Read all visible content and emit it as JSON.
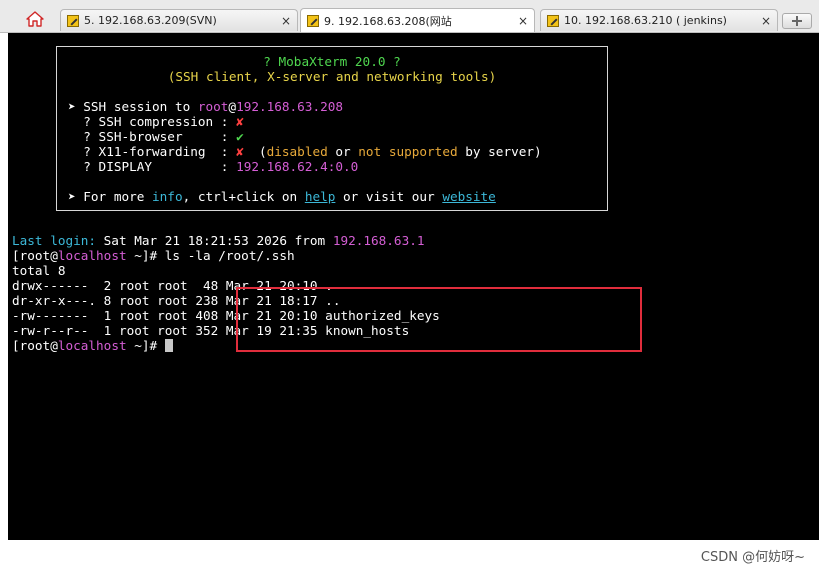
{
  "tabs": [
    {
      "label": "5. 192.168.63.209(SVN)",
      "active": false
    },
    {
      "label": "9. 192.168.63.208(网站",
      "active": true
    },
    {
      "label": "10. 192.168.63.210 ( jenkins)",
      "active": false
    }
  ],
  "tab_close": "×",
  "banner": {
    "title": "? MobaXterm 20.0 ?",
    "subtitle": "(SSH client, X-server and networking tools)",
    "ssh_session_prefix": "➤ SSH session to ",
    "user": "root",
    "at": "@",
    "host": "192.168.63.208",
    "rows": [
      {
        "label": "  ? SSH compression : ",
        "value": "✘"
      },
      {
        "label": "  ? SSH-browser     : ",
        "value": "✔"
      },
      {
        "label": "  ? X11-forwarding  : ",
        "value": "✘"
      },
      {
        "label": "  ? DISPLAY         : ",
        "value": "192.168.62.4:0.0"
      }
    ],
    "x11_note_open": "  (",
    "x11_disabled": "disabled",
    "x11_or": " or ",
    "x11_not_supported": "not supported",
    "x11_by_server": " by server)",
    "more_prefix": "➤ For more ",
    "more_info": "info",
    "more_mid": ", ctrl+click on ",
    "more_help": "help",
    "more_or": " or visit our ",
    "more_website": "website"
  },
  "terminal": {
    "last_login_label": "Last login:",
    "last_login_text": " Sat Mar 21 18:21:53 2026 from ",
    "last_login_ip": "192.168.63.1",
    "prompt_open": "[root@",
    "prompt_host": "localhost",
    "prompt_close": " ~]# ",
    "command": "ls -la /root/.ssh",
    "lines": [
      "total 8",
      "drwx------  2 root root  48 Mar 21 20:10 .",
      "dr-xr-x---. 8 root root 238 Mar 21 18:17 ..",
      "-rw-------  1 root root 408 Mar 21 20:10 authorized_keys",
      "-rw-r--r--  1 root root 352 Mar 19 21:35 known_hosts"
    ],
    "final_prompt_close": " ~]# "
  },
  "watermark": "CSDN @何妨呀~",
  "colors": {
    "highlight_border": "#e02d3c",
    "terminal_bg": "#000000",
    "green": "#4fd64f",
    "yellow": "#e7d44a",
    "red": "#ff4040",
    "magenta": "#d45ed4",
    "cyan": "#3cb8d8"
  },
  "icons": [
    "home-icon",
    "tool-icon",
    "close-icon",
    "new-tab-icon"
  ]
}
